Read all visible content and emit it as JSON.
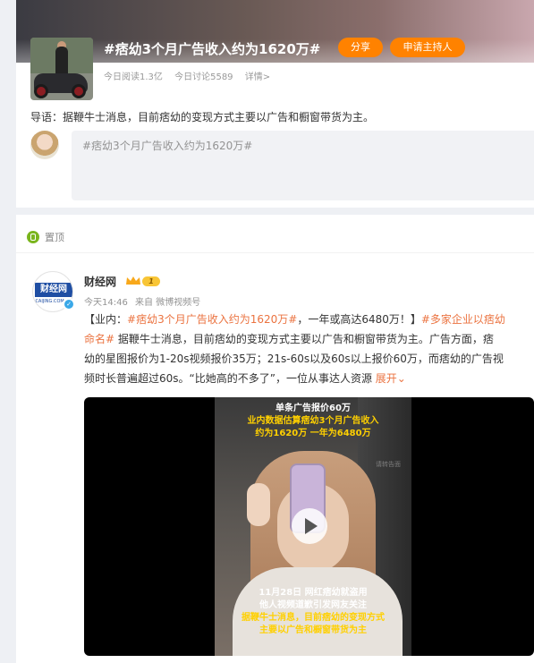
{
  "topic": {
    "title": "#痞幼3个月广告收入约为1620万#",
    "share_label": "分享",
    "host_label": "申请主持人",
    "reads_today": "今日阅读1.3亿",
    "discuss_today": "今日讨论5589",
    "details_link": "详情>",
    "intro": "导语：据鞭牛士消息，目前痞幼的变现方式主要以广告和橱窗带货为主。",
    "compose_placeholder": "#痞幼3个月广告收入约为1620万#"
  },
  "feed": {
    "pinned_label": "置顶",
    "post": {
      "author": "财经网",
      "author_logo_text": "财经网",
      "author_logo_sub": "CAIJING.COM.CN",
      "level": "1",
      "time": "今天14:46",
      "source": "来自 微博视频号",
      "text": {
        "bracket_open": "【业内：",
        "topic_link": "#痞幼3个月广告收入约为1620万#",
        "after_topic": "，一年或高达6480万！】",
        "topic_link2": "#多家企业以痞幼",
        "topic_link2_cont": "命名#",
        "line2_rest": " 据鞭牛士消息，目前痞幼的变现方式主要以广告和橱窗带货为主。广告方面，痞",
        "line3": "幼的星图报价为1-20s视频报价35万；21s-60s以及60s以上报价60万，而痞幼的广告视",
        "line4": "频时长普遍超过60s。“比她高的不多了”，一位从事达人资源 ",
        "expand": "展开⌄"
      },
      "video": {
        "caption_top1": "单条广告报价60万",
        "caption_top2": "业内数据估算痞幼3个月广告收入",
        "caption_top3": "约为1620万 一年为6480万",
        "watermark": "请转告面",
        "caption_bot1": "11月28日 网红痞幼就盗用",
        "caption_bot2": "他人视频道歉引发网友关注",
        "caption_bot3": "据鞭牛士消息，目前痞幼的变现方式",
        "caption_bot4": "主要以广告和橱窗带货为主"
      }
    }
  },
  "colors": {
    "accent_orange": "#ff8200",
    "link_orange": "#eb7340",
    "verify_blue": "#3aa8e8",
    "pin_green": "#7ab51d"
  }
}
